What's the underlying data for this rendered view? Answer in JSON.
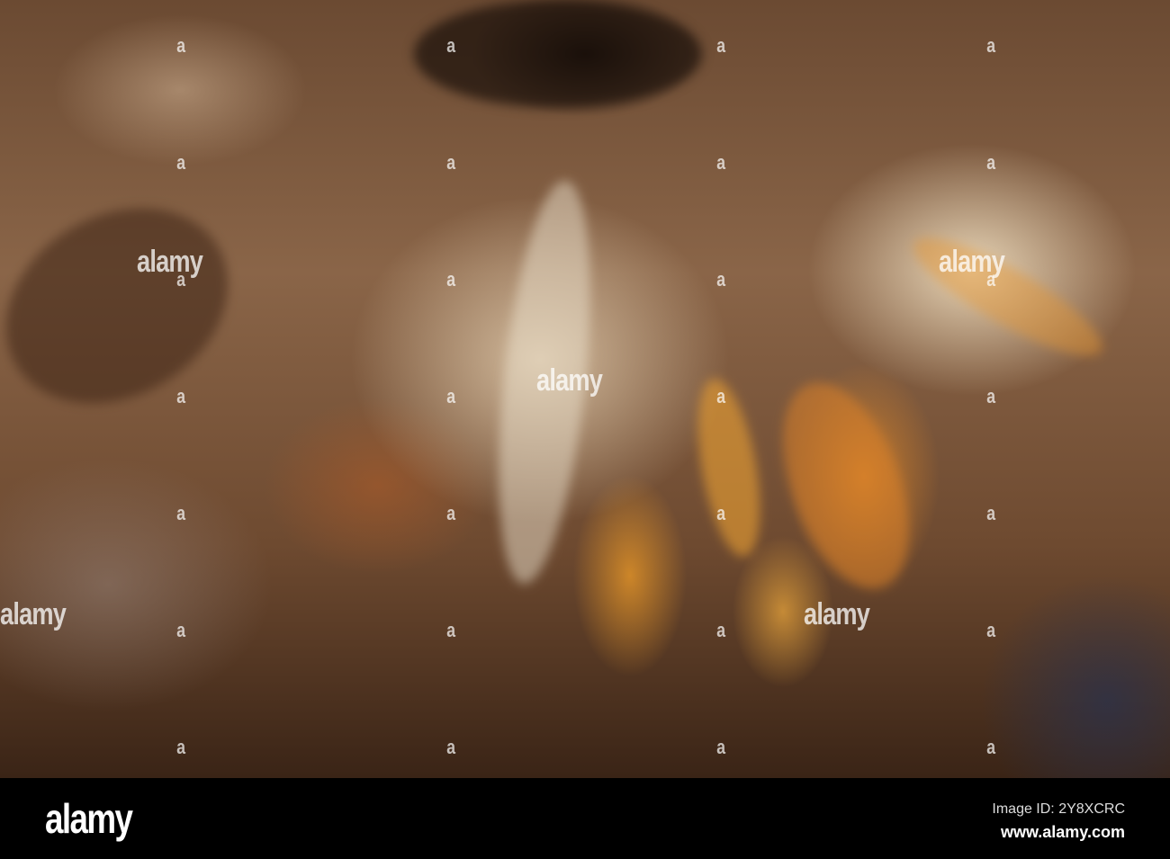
{
  "watermark": {
    "text": "alamy",
    "tile_text": "a"
  },
  "footer": {
    "logo": "alamy",
    "image_id": "Image ID: 2Y8XCRC",
    "website": "www.alamy.com"
  }
}
